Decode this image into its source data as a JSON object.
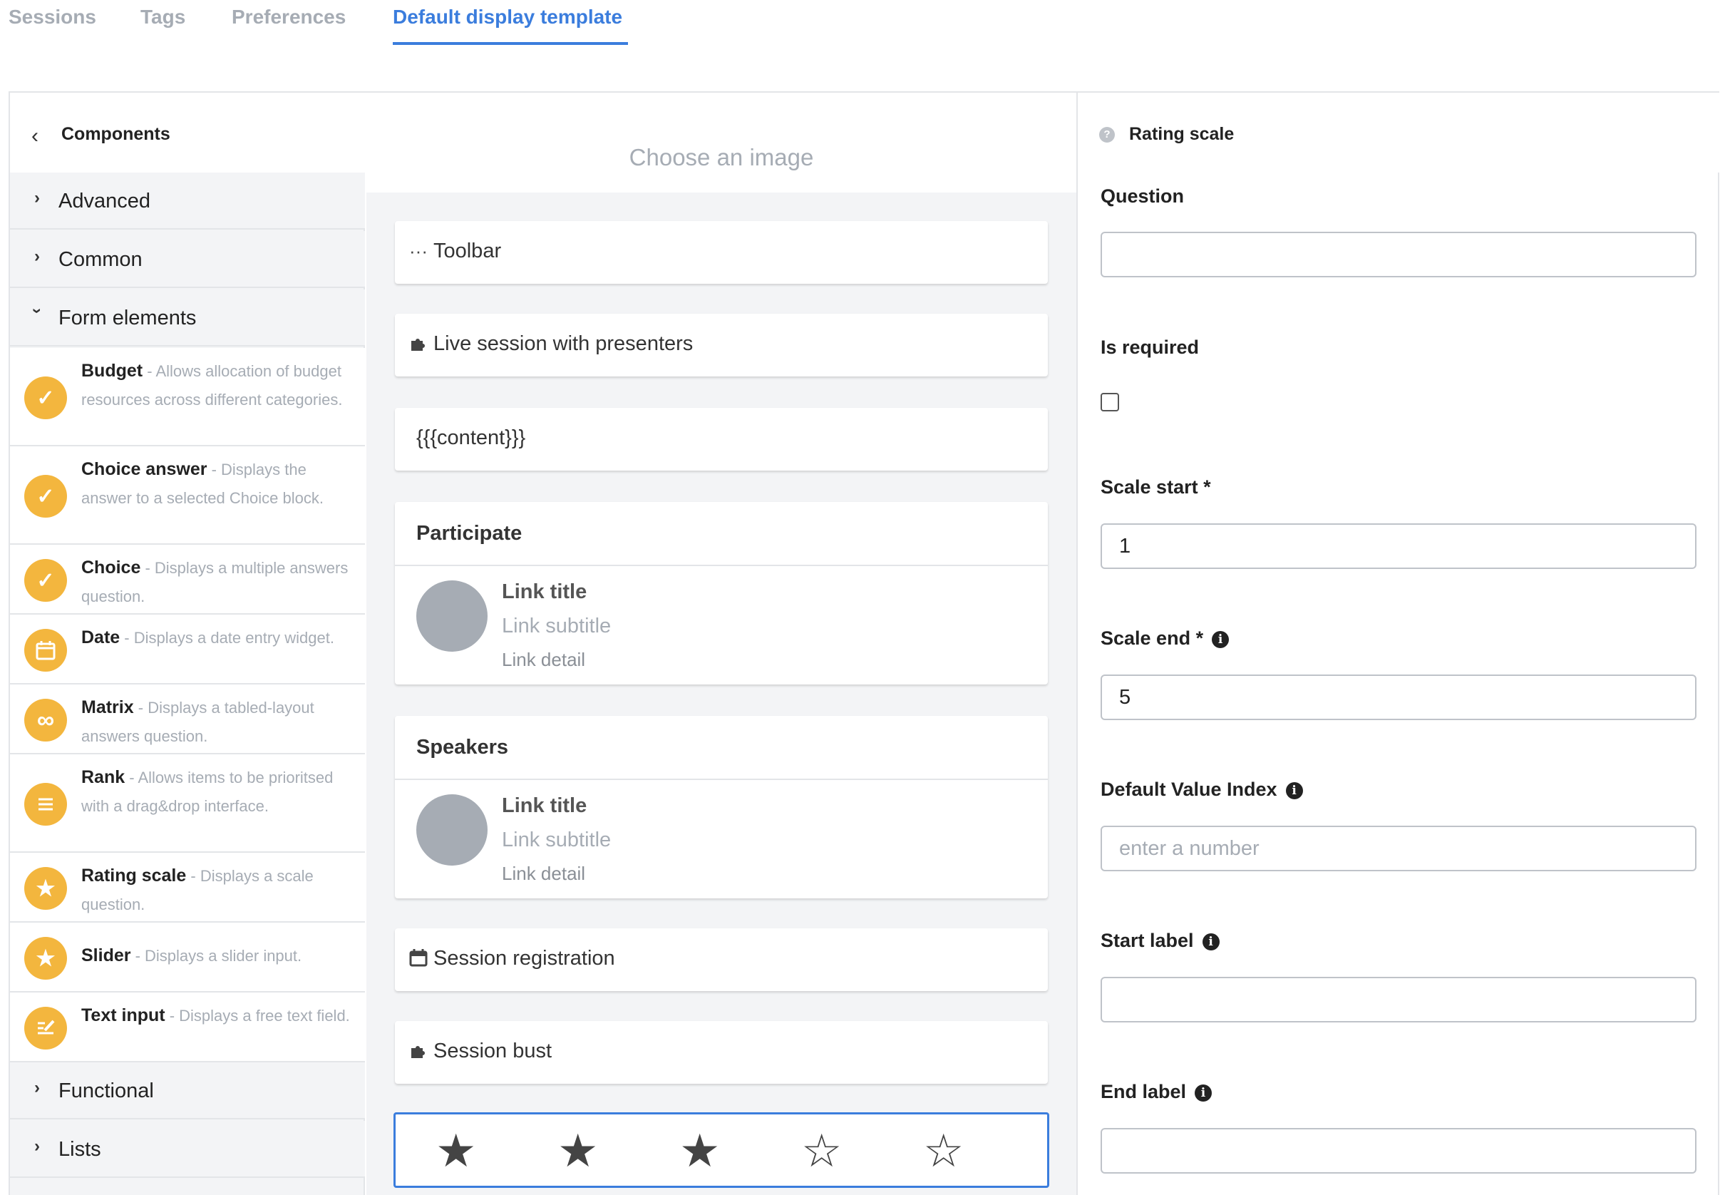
{
  "tabs": [
    {
      "label": "Sessions",
      "active": false
    },
    {
      "label": "Tags",
      "active": false
    },
    {
      "label": "Preferences",
      "active": false
    },
    {
      "label": "Default display template",
      "active": true
    }
  ],
  "left_panel": {
    "back_icon": "chevron-left-icon",
    "title": "Components",
    "categories": [
      {
        "label": "Advanced",
        "expanded": false
      },
      {
        "label": "Common",
        "expanded": false
      },
      {
        "label": "Form elements",
        "expanded": true
      },
      {
        "label": "Functional",
        "expanded": false
      },
      {
        "label": "Lists",
        "expanded": false
      }
    ],
    "components": [
      {
        "name": "Budget",
        "desc": " - Allows allocation of budget resources across different categories.",
        "icon": "check-icon"
      },
      {
        "name": "Choice answer",
        "desc": " - Displays the answer to a selected Choice block.",
        "icon": "check-icon"
      },
      {
        "name": "Choice",
        "desc": " - Displays a multiple answers question.",
        "icon": "check-icon"
      },
      {
        "name": "Date",
        "desc": " - Displays a date entry widget.",
        "icon": "calendar-icon"
      },
      {
        "name": "Matrix",
        "desc": " - Displays a tabled-layout answers question.",
        "icon": "infinity-icon"
      },
      {
        "name": "Rank",
        "desc": " - Allows items to be prioritsed with a drag&drop interface.",
        "icon": "list-icon"
      },
      {
        "name": "Rating scale",
        "desc": " - Displays a scale question.",
        "icon": "star-icon"
      },
      {
        "name": "Slider",
        "desc": " - Displays a slider input.",
        "icon": "star-icon"
      },
      {
        "name": "Text input",
        "desc": " - Displays a free text field.",
        "icon": "edit-icon"
      }
    ],
    "accent_color": "#f3b63e"
  },
  "canvas": {
    "image_placeholder": "Choose an image",
    "toolbar": {
      "label": "Toolbar",
      "icon": "ellipsis-icon"
    },
    "live_session": {
      "label": "Live session with presenters",
      "icon": "puzzle-icon"
    },
    "content": {
      "label": "{{{content}}}"
    },
    "participate": {
      "title": "Participate",
      "link_title": "Link title",
      "link_subtitle": "Link subtitle",
      "link_detail": "Link detail"
    },
    "speakers": {
      "title": "Speakers",
      "link_title": "Link title",
      "link_subtitle": "Link subtitle",
      "link_detail": "Link detail"
    },
    "session_registration": {
      "label": "Session registration",
      "icon": "calendar-icon"
    },
    "session_bust": {
      "label": "Session bust",
      "icon": "puzzle-icon"
    },
    "rating": {
      "max": 5,
      "filled": 3
    },
    "selected_border_color": "#3b7ddd"
  },
  "properties": {
    "title": "Rating scale",
    "help_icon": "question-circle-icon",
    "question_label": "Question",
    "question_value": "",
    "required_label": "Is required",
    "required_checked": false,
    "scale_start_label": "Scale start *",
    "scale_start_value": "1",
    "scale_end_label": "Scale end *",
    "scale_end_value": "5",
    "default_index_label": "Default Value Index",
    "default_index_placeholder": "enter a number",
    "start_label_label": "Start label",
    "start_label_value": "",
    "end_label_label": "End label",
    "end_label_value": "",
    "info_icon": "info-circle-icon"
  }
}
